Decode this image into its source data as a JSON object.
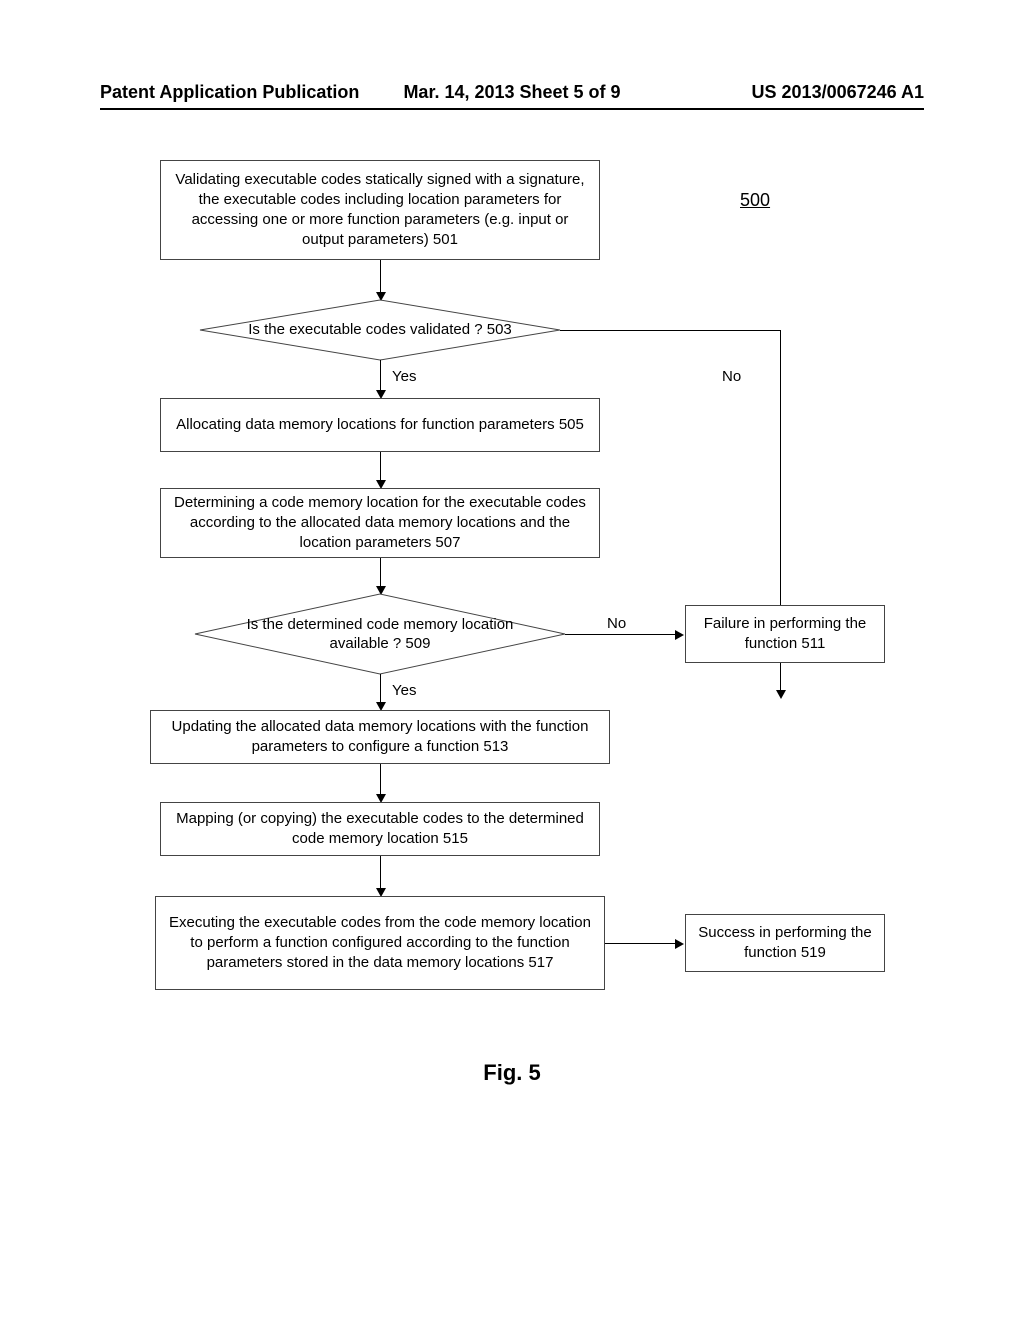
{
  "header": {
    "left": "Patent Application Publication",
    "center": "Mar. 14, 2013  Sheet 5 of 9",
    "right": "US 2013/0067246 A1"
  },
  "ref_number": "500",
  "nodes": {
    "n501": "Validating executable codes statically signed with a signature, the executable codes including location parameters for accessing one or more function parameters (e.g. input or output parameters) 501",
    "n503": "Is the executable codes validated ? 503",
    "n505": "Allocating data memory locations for function parameters 505",
    "n507": "Determining a code memory location for the executable codes according to the allocated data memory locations and the location parameters 507",
    "n509": "Is the determined code memory location available ? 509",
    "n511": "Failure in performing the function 511",
    "n513": "Updating the allocated data memory locations with the function parameters to configure a function 513",
    "n515": "Mapping (or copying) the executable codes to the determined code memory location 515",
    "n517": "Executing the executable codes from the code memory location to perform a function configured according to the function parameters stored in the data memory locations 517",
    "n519": "Success in performing the function 519"
  },
  "edge_labels": {
    "yes1": "Yes",
    "no1": "No",
    "yes2": "Yes",
    "no2": "No"
  },
  "figure_label": "Fig. 5"
}
